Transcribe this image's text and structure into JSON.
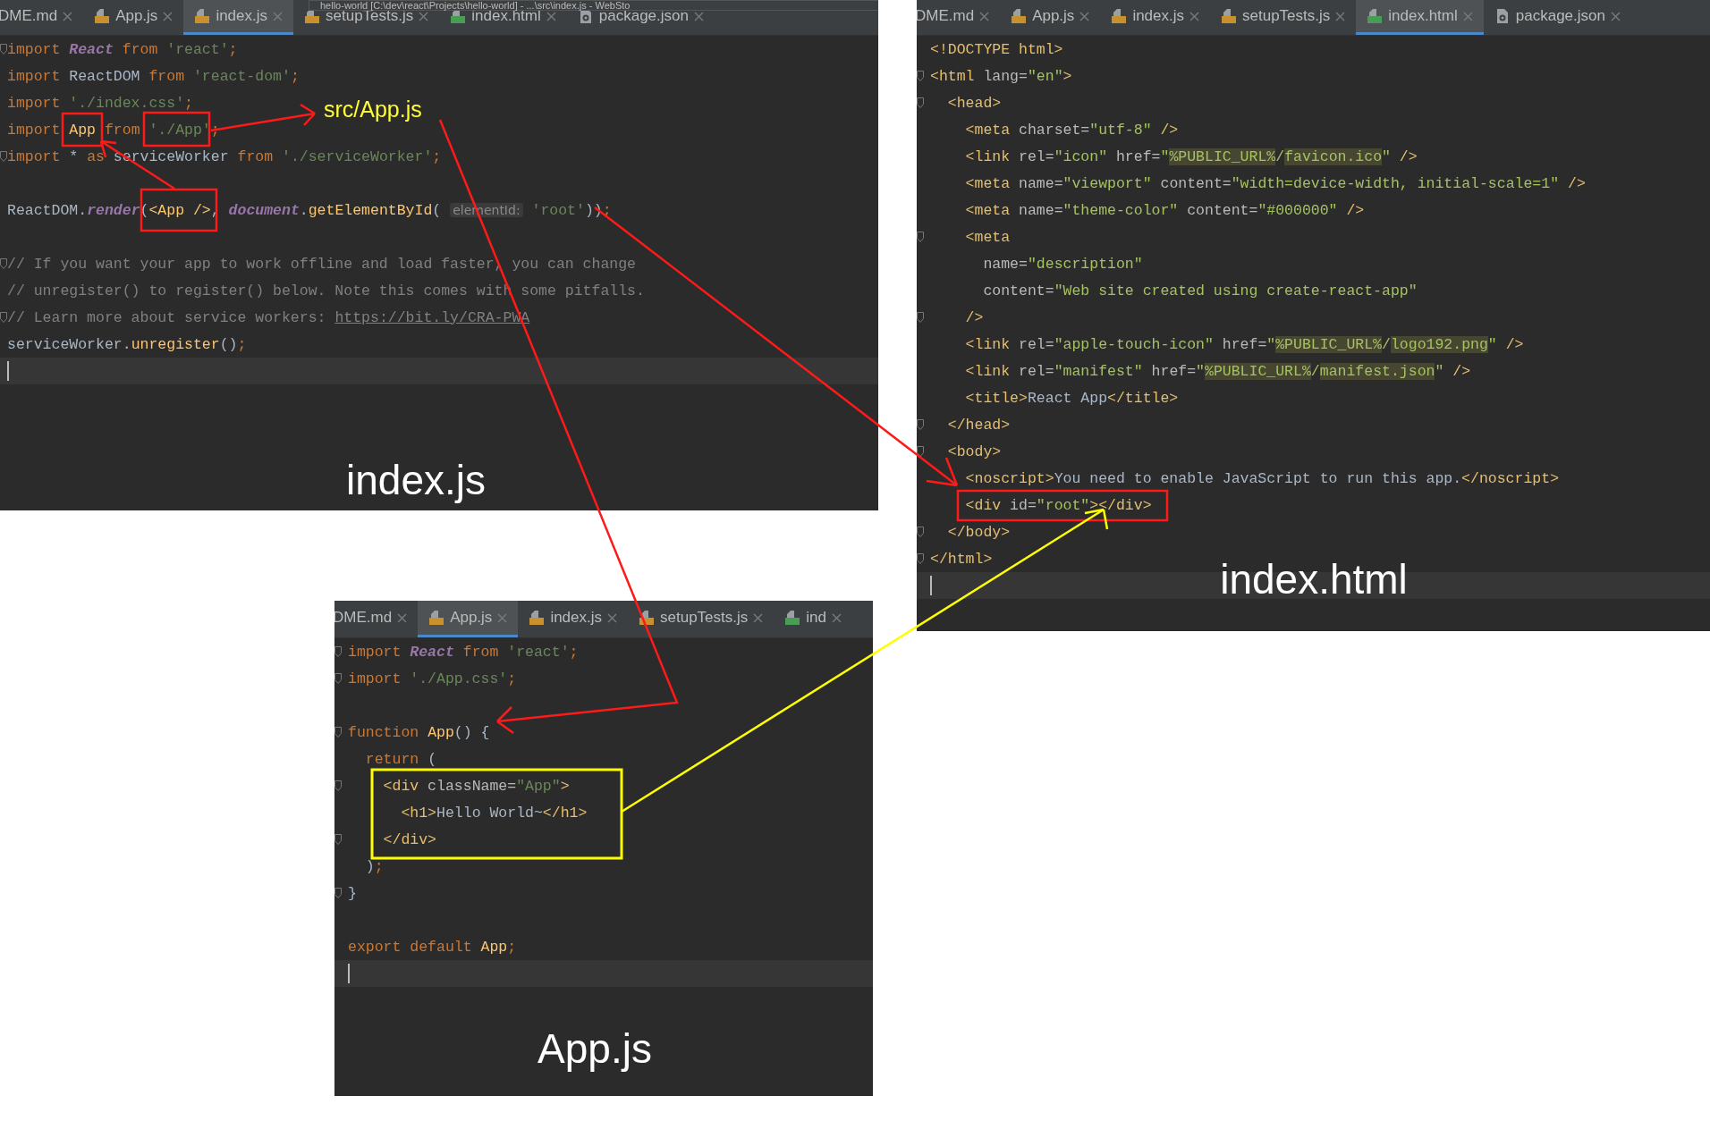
{
  "annotation_label": "src/App.js",
  "panels": [
    {
      "window_title": "hello-world [C:\\dev\\react\\Projects\\hello-world] - ...\\src\\index.js - WebSto",
      "caption": "index.js",
      "tabs": [
        {
          "label": "DME.md",
          "kind": "md",
          "selected": false
        },
        {
          "label": "App.js",
          "kind": "js",
          "selected": false
        },
        {
          "label": "index.js",
          "kind": "js",
          "selected": true
        },
        {
          "label": "setupTests.js",
          "kind": "js",
          "selected": false
        },
        {
          "label": "index.html",
          "kind": "html",
          "selected": false
        },
        {
          "label": "package.json",
          "kind": "json",
          "selected": false
        }
      ],
      "lines": [
        {
          "fold": true,
          "current": false,
          "tokens": [
            {
              "kind": "kw",
              "text": "import "
            },
            {
              "kind": "it",
              "text": "React"
            },
            {
              "kind": "kw",
              "text": " from "
            },
            {
              "kind": "str",
              "text": "'react'"
            },
            {
              "kind": "kw",
              "text": ";"
            }
          ]
        },
        {
          "fold": false,
          "current": false,
          "tokens": [
            {
              "kind": "kw",
              "text": "import "
            },
            {
              "kind": "id",
              "text": "ReactDOM"
            },
            {
              "kind": "kw",
              "text": " from "
            },
            {
              "kind": "str",
              "text": "'react-dom'"
            },
            {
              "kind": "kw",
              "text": ";"
            }
          ]
        },
        {
          "fold": false,
          "current": false,
          "tokens": [
            {
              "kind": "kw",
              "text": "import "
            },
            {
              "kind": "str",
              "text": "'./index.css'"
            },
            {
              "kind": "kw",
              "text": ";"
            }
          ]
        },
        {
          "fold": false,
          "current": false,
          "tokens": [
            {
              "kind": "kw",
              "text": "import "
            },
            {
              "kind": "fn",
              "text": "App"
            },
            {
              "kind": "kw",
              "text": " from "
            },
            {
              "kind": "str",
              "text": "'./App'"
            },
            {
              "kind": "kw",
              "text": ";"
            }
          ]
        },
        {
          "fold": true,
          "current": false,
          "tokens": [
            {
              "kind": "kw",
              "text": "import "
            },
            {
              "kind": "id",
              "text": "* "
            },
            {
              "kind": "kw",
              "text": "as "
            },
            {
              "kind": "id",
              "text": "serviceWorker"
            },
            {
              "kind": "kw",
              "text": " from "
            },
            {
              "kind": "str",
              "text": "'./serviceWorker'"
            },
            {
              "kind": "kw",
              "text": ";"
            }
          ]
        },
        {
          "fold": false,
          "current": false
        },
        {
          "fold": false,
          "current": false,
          "tokens": [
            {
              "kind": "id",
              "text": "ReactDOM."
            },
            {
              "kind": "it",
              "text": "render"
            },
            {
              "kind": "id",
              "text": "("
            },
            {
              "kind": "fn",
              "text": "<App />"
            },
            {
              "kind": "id",
              "text": ", "
            },
            {
              "kind": "it",
              "text": "document"
            },
            {
              "kind": "id",
              "text": "."
            },
            {
              "kind": "fn",
              "text": "getElementById"
            },
            {
              "kind": "id",
              "text": "( "
            },
            {
              "kind": "hint",
              "text": "elementId:"
            },
            {
              "kind": "str",
              "text": " 'root'"
            },
            {
              "kind": "id",
              "text": "))"
            },
            {
              "kind": "kw",
              "text": ";"
            }
          ]
        },
        {
          "fold": false,
          "current": false
        },
        {
          "fold": true,
          "current": false,
          "tokens": [
            {
              "kind": "cm",
              "text": "// If you want your app to work offline and load faster, you can change"
            }
          ]
        },
        {
          "fold": false,
          "current": false,
          "tokens": [
            {
              "kind": "cm",
              "text": "// unregister() to register() below. Note this comes with some pitfalls."
            }
          ]
        },
        {
          "fold": true,
          "current": false,
          "tokens": [
            {
              "kind": "cm",
              "text": "// Learn more about service workers: "
            },
            {
              "kind": "link",
              "text": "https://bit.ly/CRA-PWA"
            }
          ]
        },
        {
          "fold": false,
          "current": false,
          "tokens": [
            {
              "kind": "id",
              "text": "serviceWorker."
            },
            {
              "kind": "fn",
              "text": "unregister"
            },
            {
              "kind": "id",
              "text": "()"
            },
            {
              "kind": "kw",
              "text": ";"
            }
          ]
        },
        {
          "fold": false,
          "current": true
        }
      ]
    },
    {
      "caption": "index.html",
      "tabs": [
        {
          "label": "DME.md",
          "kind": "md",
          "selected": false
        },
        {
          "label": "App.js",
          "kind": "js",
          "selected": false
        },
        {
          "label": "index.js",
          "kind": "js",
          "selected": false
        },
        {
          "label": "setupTests.js",
          "kind": "js",
          "selected": false
        },
        {
          "label": "index.html",
          "kind": "html",
          "selected": true
        },
        {
          "label": "package.json",
          "kind": "json",
          "selected": false
        }
      ],
      "lines": [
        {
          "fold": false,
          "current": false,
          "tokens": [
            {
              "kind": "tag",
              "text": "<!DOCTYPE html>"
            }
          ]
        },
        {
          "fold": true,
          "current": false,
          "tokens": [
            {
              "kind": "tag",
              "text": "<html"
            },
            {
              "kind": "attr",
              "text": " lang="
            },
            {
              "kind": "val",
              "text": "\"en\""
            },
            {
              "kind": "tag",
              "text": ">"
            }
          ]
        },
        {
          "fold": true,
          "current": false,
          "tokens": [
            {
              "kind": "tag",
              "text": "  <head>"
            }
          ]
        },
        {
          "fold": false,
          "current": false,
          "tokens": [
            {
              "kind": "tag",
              "text": "    <meta"
            },
            {
              "kind": "attr",
              "text": " charset="
            },
            {
              "kind": "val",
              "text": "\"utf-8\""
            },
            {
              "kind": "tag",
              "text": " />"
            }
          ]
        },
        {
          "fold": false,
          "current": false,
          "tokens": [
            {
              "kind": "tag",
              "text": "    <link"
            },
            {
              "kind": "attr",
              "text": " rel="
            },
            {
              "kind": "val",
              "text": "\"icon\""
            },
            {
              "kind": "attr",
              "text": " href="
            },
            {
              "kind": "val",
              "text": "\""
            },
            {
              "kind": "hl",
              "text": "%PUBLIC_URL%"
            },
            {
              "kind": "val",
              "text": "/"
            },
            {
              "kind": "hl",
              "text": "favicon.ico"
            },
            {
              "kind": "val",
              "text": "\""
            },
            {
              "kind": "tag",
              "text": " />"
            }
          ]
        },
        {
          "fold": false,
          "current": false,
          "tokens": [
            {
              "kind": "tag",
              "text": "    <meta"
            },
            {
              "kind": "attr",
              "text": " name="
            },
            {
              "kind": "val",
              "text": "\"viewport\""
            },
            {
              "kind": "attr",
              "text": " content="
            },
            {
              "kind": "val",
              "text": "\"width=device-width, initial-scale=1\""
            },
            {
              "kind": "tag",
              "text": " />"
            }
          ]
        },
        {
          "fold": false,
          "current": false,
          "tokens": [
            {
              "kind": "tag",
              "text": "    <meta"
            },
            {
              "kind": "attr",
              "text": " name="
            },
            {
              "kind": "val",
              "text": "\"theme-color\""
            },
            {
              "kind": "attr",
              "text": " content="
            },
            {
              "kind": "val",
              "text": "\"#000000\""
            },
            {
              "kind": "tag",
              "text": " />"
            }
          ]
        },
        {
          "fold": true,
          "current": false,
          "tokens": [
            {
              "kind": "tag",
              "text": "    <meta"
            }
          ]
        },
        {
          "fold": false,
          "current": false,
          "tokens": [
            {
              "kind": "attr",
              "text": "      name="
            },
            {
              "kind": "val",
              "text": "\"description\""
            }
          ]
        },
        {
          "fold": false,
          "current": false,
          "tokens": [
            {
              "kind": "attr",
              "text": "      content="
            },
            {
              "kind": "val",
              "text": "\"Web site created using create-react-app\""
            }
          ]
        },
        {
          "fold": true,
          "current": false,
          "tokens": [
            {
              "kind": "tag",
              "text": "    />"
            }
          ]
        },
        {
          "fold": false,
          "current": false,
          "tokens": [
            {
              "kind": "tag",
              "text": "    <link"
            },
            {
              "kind": "attr",
              "text": " rel="
            },
            {
              "kind": "val",
              "text": "\"apple-touch-icon\""
            },
            {
              "kind": "attr",
              "text": " href="
            },
            {
              "kind": "val",
              "text": "\""
            },
            {
              "kind": "hl",
              "text": "%PUBLIC_URL%"
            },
            {
              "kind": "val",
              "text": "/"
            },
            {
              "kind": "hl",
              "text": "logo192.png"
            },
            {
              "kind": "val",
              "text": "\""
            },
            {
              "kind": "tag",
              "text": " />"
            }
          ]
        },
        {
          "fold": false,
          "current": false,
          "tokens": [
            {
              "kind": "tag",
              "text": "    <link"
            },
            {
              "kind": "attr",
              "text": " rel="
            },
            {
              "kind": "val",
              "text": "\"manifest\""
            },
            {
              "kind": "attr",
              "text": " href="
            },
            {
              "kind": "val",
              "text": "\""
            },
            {
              "kind": "hl",
              "text": "%PUBLIC_URL%"
            },
            {
              "kind": "val",
              "text": "/"
            },
            {
              "kind": "hl",
              "text": "manifest.json"
            },
            {
              "kind": "val",
              "text": "\""
            },
            {
              "kind": "tag",
              "text": " />"
            }
          ]
        },
        {
          "fold": false,
          "current": false,
          "tokens": [
            {
              "kind": "tag",
              "text": "    <title>"
            },
            {
              "kind": "id",
              "text": "React App"
            },
            {
              "kind": "tag",
              "text": "</title>"
            }
          ]
        },
        {
          "fold": true,
          "current": false,
          "tokens": [
            {
              "kind": "tag",
              "text": "  </head>"
            }
          ]
        },
        {
          "fold": true,
          "current": false,
          "tokens": [
            {
              "kind": "tag",
              "text": "  <body>"
            }
          ]
        },
        {
          "fold": false,
          "current": false,
          "tokens": [
            {
              "kind": "tag",
              "text": "    <noscript>"
            },
            {
              "kind": "id",
              "text": "You need to enable JavaScript to run this app."
            },
            {
              "kind": "tag",
              "text": "</noscript>"
            }
          ]
        },
        {
          "fold": false,
          "current": false,
          "tokens": [
            {
              "kind": "tag",
              "text": "    <div"
            },
            {
              "kind": "attr",
              "text": " id="
            },
            {
              "kind": "val",
              "text": "\"root\""
            },
            {
              "kind": "tag",
              "text": "></div>"
            }
          ]
        },
        {
          "fold": true,
          "current": false,
          "tokens": [
            {
              "kind": "tag",
              "text": "  </body>"
            }
          ]
        },
        {
          "fold": true,
          "current": false,
          "tokens": [
            {
              "kind": "tag",
              "text": "</html>"
            }
          ]
        },
        {
          "fold": false,
          "current": true
        }
      ]
    },
    {
      "caption": "App.js",
      "tabs": [
        {
          "label": "DME.md",
          "kind": "md",
          "selected": false
        },
        {
          "label": "App.js",
          "kind": "js",
          "selected": true
        },
        {
          "label": "index.js",
          "kind": "js",
          "selected": false
        },
        {
          "label": "setupTests.js",
          "kind": "js",
          "selected": false
        },
        {
          "label": "ind",
          "kind": "html",
          "selected": false
        }
      ],
      "lines": [
        {
          "fold": true,
          "current": false,
          "tokens": [
            {
              "kind": "kw",
              "text": "import "
            },
            {
              "kind": "it",
              "text": "React"
            },
            {
              "kind": "kw",
              "text": " from "
            },
            {
              "kind": "str",
              "text": "'react'"
            },
            {
              "kind": "kw",
              "text": ";"
            }
          ]
        },
        {
          "fold": true,
          "current": false,
          "tokens": [
            {
              "kind": "kw",
              "text": "import "
            },
            {
              "kind": "str",
              "text": "'./App.css'"
            },
            {
              "kind": "kw",
              "text": ";"
            }
          ]
        },
        {
          "fold": false,
          "current": false
        },
        {
          "fold": true,
          "current": false,
          "tokens": [
            {
              "kind": "kw",
              "text": "function "
            },
            {
              "kind": "fn",
              "text": "App"
            },
            {
              "kind": "id",
              "text": "() {"
            }
          ]
        },
        {
          "fold": false,
          "current": false,
          "tokens": [
            {
              "kind": "kw",
              "text": "  return "
            },
            {
              "kind": "id",
              "text": "("
            }
          ]
        },
        {
          "fold": true,
          "current": false,
          "tokens": [
            {
              "kind": "tag",
              "text": "    <div"
            },
            {
              "kind": "attr",
              "text": " className="
            },
            {
              "kind": "str",
              "text": "\"App\""
            },
            {
              "kind": "tag",
              "text": ">"
            }
          ]
        },
        {
          "fold": false,
          "current": false,
          "tokens": [
            {
              "kind": "tag",
              "text": "      <h1>"
            },
            {
              "kind": "id",
              "text": "Hello World~"
            },
            {
              "kind": "tag",
              "text": "</h1>"
            }
          ]
        },
        {
          "fold": true,
          "current": false,
          "tokens": [
            {
              "kind": "tag",
              "text": "    </div>"
            }
          ]
        },
        {
          "fold": false,
          "current": false,
          "tokens": [
            {
              "kind": "id",
              "text": "  )"
            },
            {
              "kind": "kw",
              "text": ";"
            }
          ]
        },
        {
          "fold": true,
          "current": false,
          "tokens": [
            {
              "kind": "id",
              "text": "}"
            }
          ]
        },
        {
          "fold": false,
          "current": false
        },
        {
          "fold": false,
          "current": false,
          "tokens": [
            {
              "kind": "kw",
              "text": "export default "
            },
            {
              "kind": "fn",
              "text": "App"
            },
            {
              "kind": "kw",
              "text": ";"
            }
          ]
        },
        {
          "fold": false,
          "current": true
        }
      ]
    }
  ]
}
